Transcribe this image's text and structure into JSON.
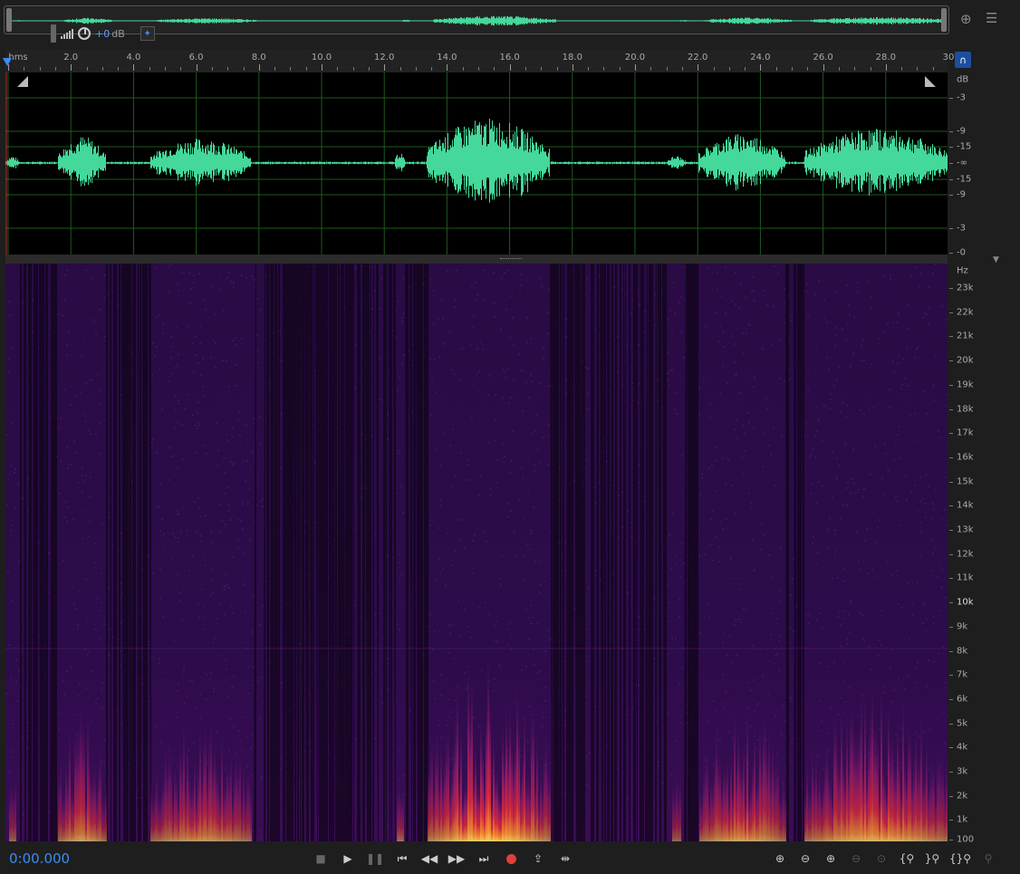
{
  "overview": {
    "gain_value": "+0",
    "gain_unit": "dB"
  },
  "header_icons": {
    "zoom_icon": "zoom-icon",
    "layout_icon": "layout-icon"
  },
  "ruler": {
    "unit_label": "hms",
    "labels": [
      "2.0",
      "4.0",
      "6.0",
      "8.0",
      "10.0",
      "12.0",
      "14.0",
      "16.0",
      "18.0",
      "20.0",
      "22.0",
      "24.0",
      "26.0",
      "28.0",
      "30"
    ]
  },
  "waveform": {
    "scale_title": "dB",
    "scale_labels": [
      "-3",
      "-9",
      "-15",
      "-∞",
      "-15",
      "-9",
      "-3",
      "-0"
    ],
    "color": "#44d89a",
    "center_line_color": "#d04040"
  },
  "spectrogram": {
    "scale_title": "Hz",
    "labels": [
      "23k",
      "22k",
      "21k",
      "20k",
      "19k",
      "18k",
      "17k",
      "16k",
      "15k",
      "14k",
      "13k",
      "12k",
      "11k",
      "10k",
      "9k",
      "8k",
      "7k",
      "6k",
      "5k",
      "4k",
      "3k",
      "2k",
      "1k",
      "100"
    ]
  },
  "transport": {
    "time": "0:00.000",
    "accent_color": "#3b8cf5",
    "record_color": "#e0403a"
  }
}
